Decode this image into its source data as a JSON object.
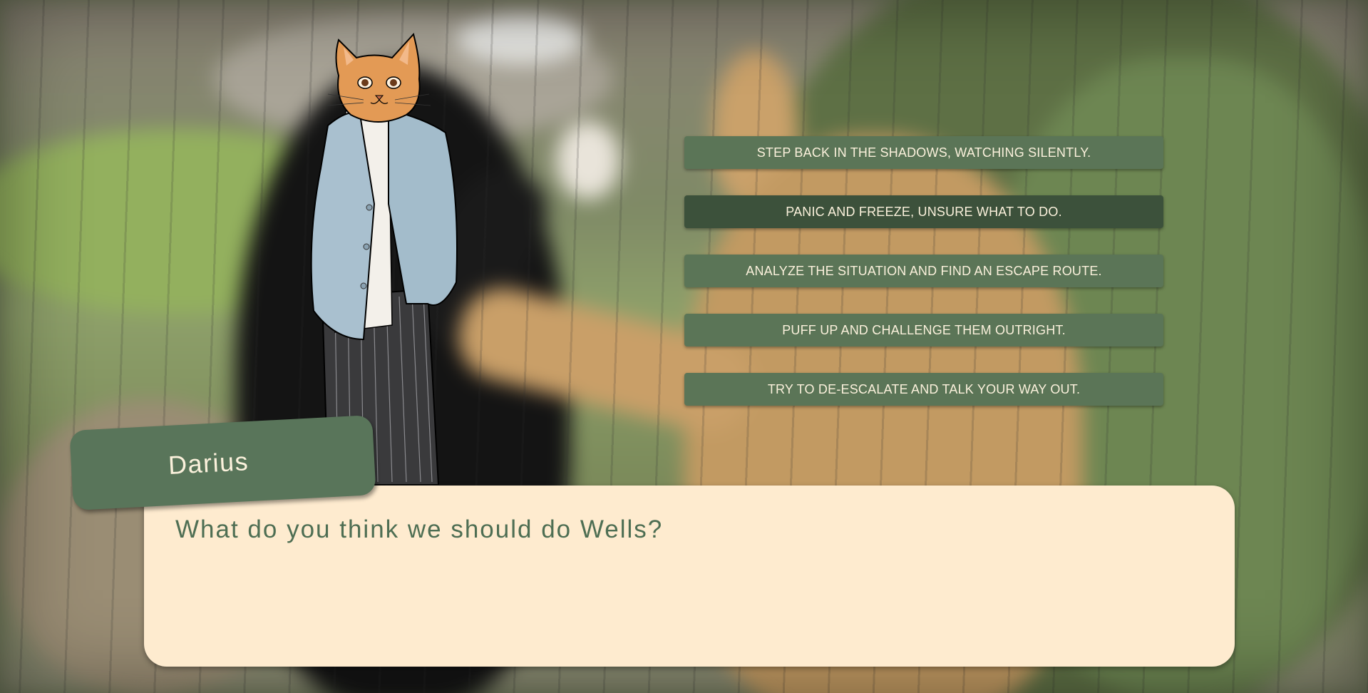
{
  "scene": {
    "background": "blurred-photo-black-and-orange-cats-by-fence",
    "character_sprite": "cat-headed-man-in-blue-cardigan"
  },
  "colors": {
    "choice_bg": "#5b7557",
    "choice_hover_bg": "#3c513b",
    "choice_text": "#fbf1dc",
    "dialogue_bg": "#feebcf",
    "dialogue_text": "#4e6e53",
    "name_tag_bg": "#59755a"
  },
  "choices": [
    {
      "label": "STEP BACK IN THE SHADOWS, WATCHING SILENTLY."
    },
    {
      "label": "PANIC AND FREEZE, UNSURE WHAT TO DO."
    },
    {
      "label": "ANALYZE THE SITUATION AND FIND AN ESCAPE ROUTE."
    },
    {
      "label": "PUFF UP AND CHALLENGE THEM OUTRIGHT."
    },
    {
      "label": "TRY TO DE-ESCALATE AND TALK YOUR WAY OUT."
    }
  ],
  "dialogue": {
    "speaker": "Darius",
    "text": "What do you think we should do Wells?"
  }
}
